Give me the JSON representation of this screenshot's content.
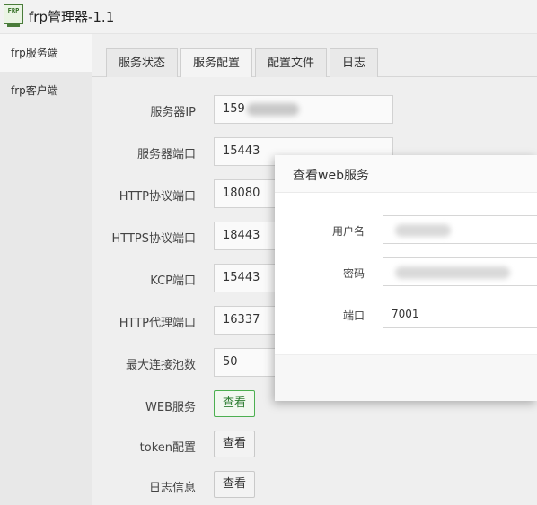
{
  "window": {
    "title": "frp管理器-1.1",
    "logo_text": "FRP"
  },
  "sidebar": {
    "items": [
      {
        "label": "frp服务端",
        "active": true
      },
      {
        "label": "frp客户端",
        "active": false
      }
    ]
  },
  "tabs": [
    "服务状态",
    "服务配置",
    "配置文件",
    "日志"
  ],
  "active_tab": "服务配置",
  "form": {
    "server_ip": {
      "label": "服务器IP",
      "value": "159"
    },
    "server_port": {
      "label": "服务器端口",
      "value": "15443"
    },
    "http_port": {
      "label": "HTTP协议端口",
      "value": "18080"
    },
    "https_port": {
      "label": "HTTPS协议端口",
      "value": "18443"
    },
    "kcp_port": {
      "label": "KCP端口",
      "value": "15443"
    },
    "http_proxy_port": {
      "label": "HTTP代理端口",
      "value": "16337"
    },
    "max_pool": {
      "label": "最大连接池数",
      "value": "50"
    },
    "web_service": {
      "label": "WEB服务",
      "button": "查看"
    },
    "token_config": {
      "label": "token配置",
      "button": "查看"
    },
    "log_info": {
      "label": "日志信息",
      "button": "查看"
    }
  },
  "dialog": {
    "title": "查看web服务",
    "username_label": "用户名",
    "password_label": "密码",
    "port_label": "端口",
    "port_value": "7001"
  },
  "colors": {
    "accent_green": "#4caf50",
    "sidebar_bg": "#e8e8e8",
    "content_bg": "#efefef"
  }
}
